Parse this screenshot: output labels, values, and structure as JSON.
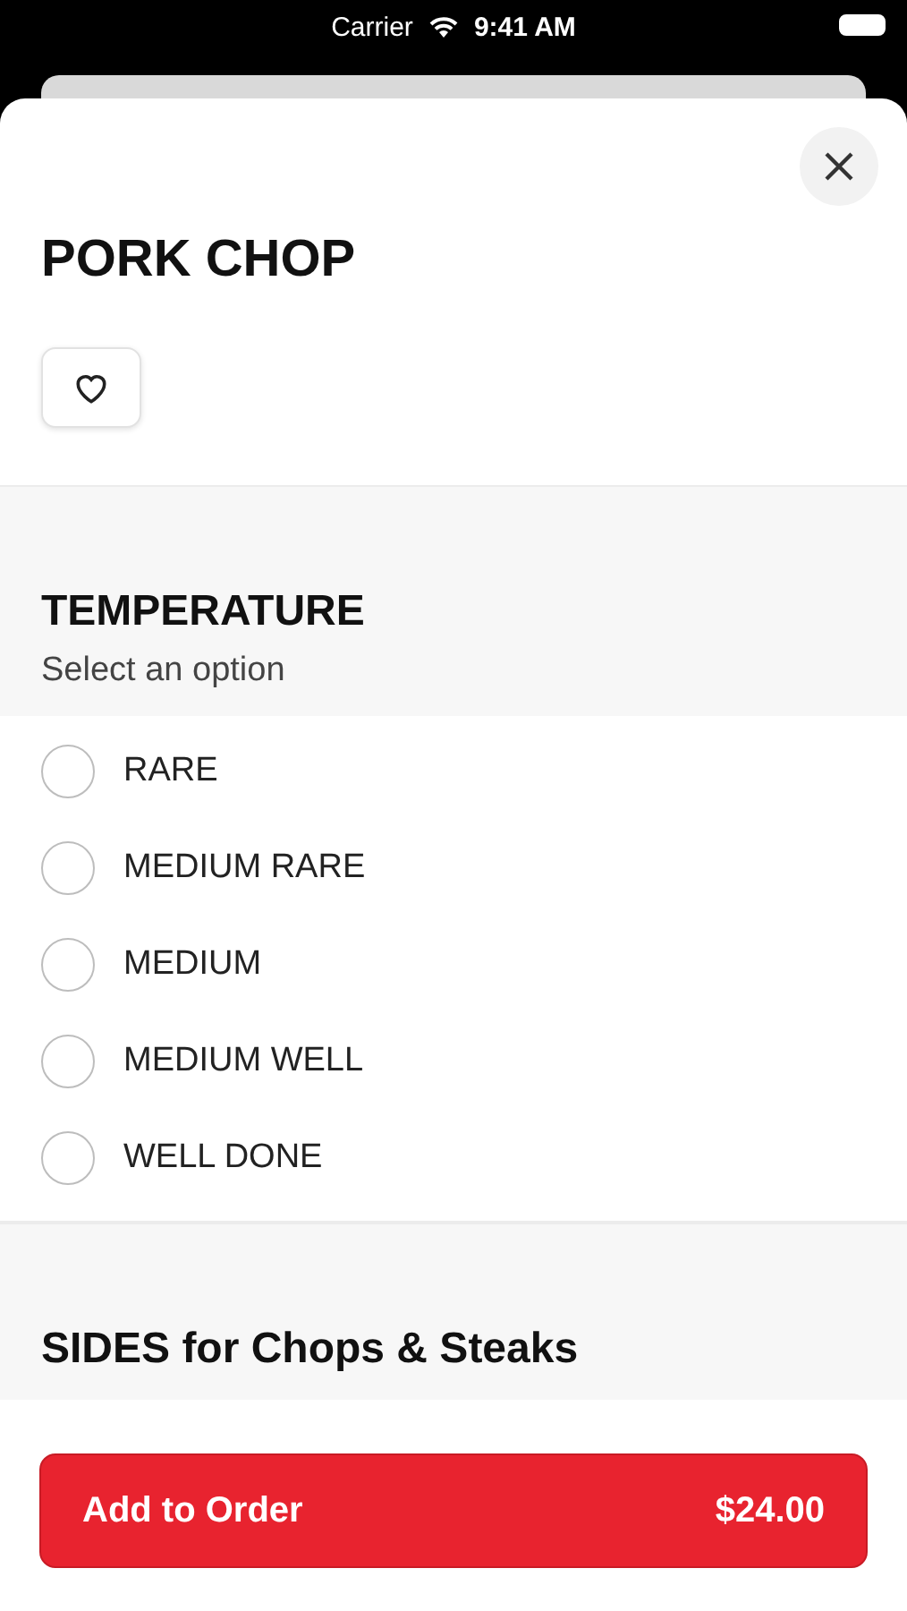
{
  "status_bar": {
    "carrier": "Carrier",
    "time": "9:41 AM"
  },
  "item": {
    "title": "PORK CHOP",
    "favorite": false
  },
  "sections": [
    {
      "title": "TEMPERATURE",
      "subtitle": "Select an option",
      "options": [
        {
          "label": "RARE",
          "selected": false
        },
        {
          "label": "MEDIUM RARE",
          "selected": false
        },
        {
          "label": "MEDIUM",
          "selected": false
        },
        {
          "label": "MEDIUM WELL",
          "selected": false
        },
        {
          "label": "WELL DONE",
          "selected": false
        }
      ]
    },
    {
      "title": "SIDES for Chops & Steaks"
    }
  ],
  "footer": {
    "button_label": "Add to Order",
    "price": "$24.00"
  }
}
